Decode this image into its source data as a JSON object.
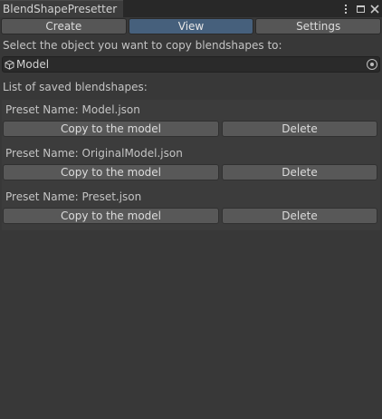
{
  "window": {
    "title": "BlendShapePresetter"
  },
  "toolbar": {
    "tabs": [
      {
        "label": "Create",
        "selected": false
      },
      {
        "label": "View",
        "selected": true
      },
      {
        "label": "Settings",
        "selected": false
      }
    ]
  },
  "main": {
    "select_label": "Select the object you want to copy blendshapes to:",
    "object_field_value": "Model",
    "list_label": "List of saved blendshapes:"
  },
  "presets": [
    {
      "name": "Preset Name: Model.json",
      "copy_label": "Copy to the model",
      "delete_label": "Delete"
    },
    {
      "name": "Preset Name: OriginalModel.json",
      "copy_label": "Copy to the model",
      "delete_label": "Delete"
    },
    {
      "name": "Preset Name: Preset.json",
      "copy_label": "Copy to the model",
      "delete_label": "Delete"
    }
  ],
  "colors": {
    "background": "#383838",
    "selected_tab": "#46607c",
    "button": "#585858",
    "titlebar": "#282828"
  },
  "icons": {
    "menu": "kebab-menu-icon",
    "maximize": "maximize-icon",
    "close": "close-icon",
    "object": "cube-icon",
    "picker": "object-picker-icon"
  }
}
